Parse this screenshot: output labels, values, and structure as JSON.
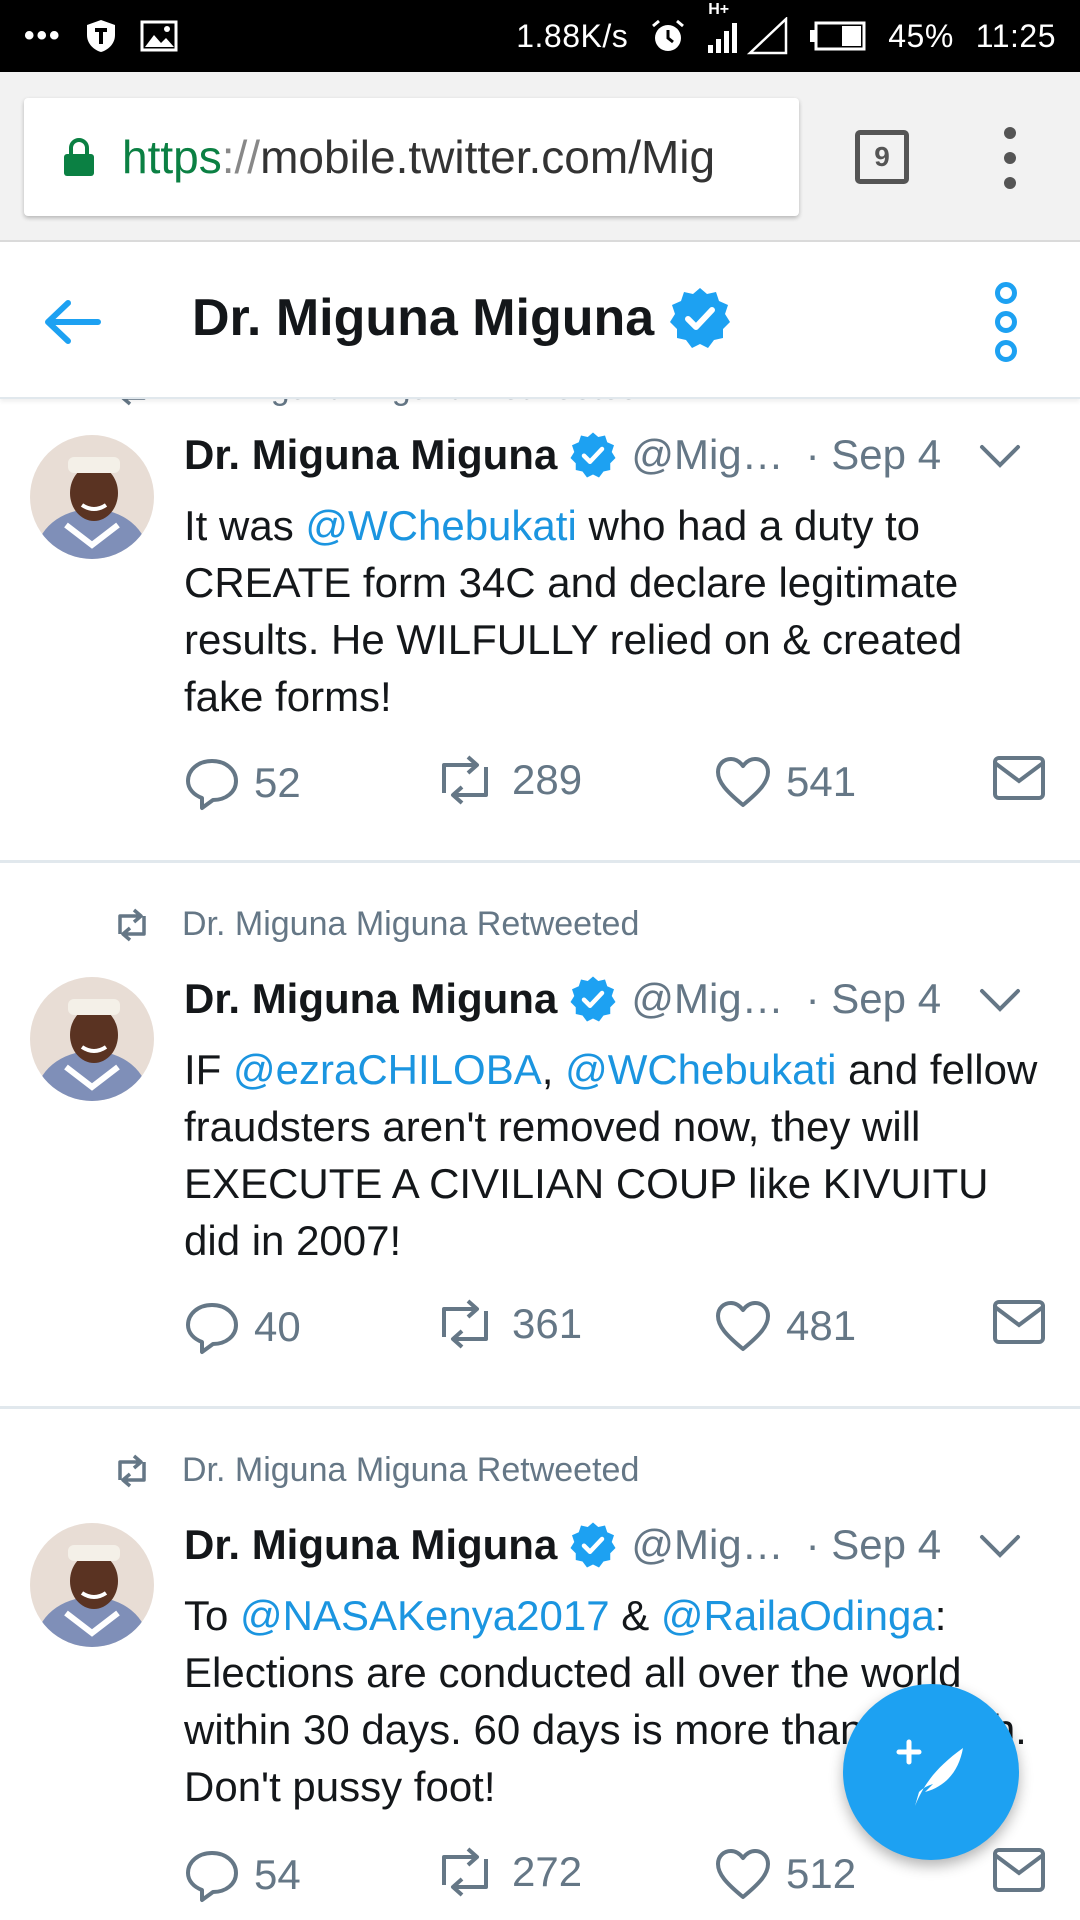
{
  "status_bar": {
    "speed": "1.88K/s",
    "network_label": "H+",
    "battery": "45%",
    "time": "11:25",
    "icons": [
      "more-dots-icon",
      "shield-app-icon",
      "image-icon",
      "alarm-icon",
      "signal-icon",
      "battery-icon"
    ]
  },
  "browser": {
    "url_scheme": "https",
    "url_sep": "://",
    "url_rest": "mobile.twitter.com/Mig",
    "tab_count": "9"
  },
  "header": {
    "title": "Dr. Miguna Miguna"
  },
  "colors": {
    "twitter_blue": "#1da1f2",
    "mention_blue": "#1b95e0",
    "secure_green": "#0b8043",
    "muted_gray": "#657786"
  },
  "partial_retweet_label": "Dr. Miguna Miguna Retweeted",
  "tweets": [
    {
      "retweeted_by": "",
      "name": "Dr. Miguna Miguna",
      "handle": "@Mig…",
      "date": "· Sep 4",
      "body_segments": [
        {
          "text": "It was ",
          "type": "text"
        },
        {
          "text": "@WChebukati",
          "type": "mention"
        },
        {
          "text": " who had a duty to CREATE form 34C and declare legitimate results. He WILFULLY relied on & created fake forms!",
          "type": "text"
        }
      ],
      "replies": "52",
      "retweets": "289",
      "likes": "541"
    },
    {
      "retweeted_by": "Dr. Miguna Miguna Retweeted",
      "name": "Dr. Miguna Miguna",
      "handle": "@Mig…",
      "date": "· Sep 4",
      "body_segments": [
        {
          "text": "IF ",
          "type": "text"
        },
        {
          "text": "@ezraCHILOBA",
          "type": "mention"
        },
        {
          "text": ", ",
          "type": "text"
        },
        {
          "text": "@WChebukati",
          "type": "mention"
        },
        {
          "text": " and fellow fraudsters aren't removed now, they will EXECUTE A CIVILIAN COUP like KIVUITU did in 2007!",
          "type": "text"
        }
      ],
      "replies": "40",
      "retweets": "361",
      "likes": "481"
    },
    {
      "retweeted_by": "Dr. Miguna Miguna Retweeted",
      "name": "Dr. Miguna Miguna",
      "handle": "@Mig…",
      "date": "· Sep 4",
      "body_segments": [
        {
          "text": "To ",
          "type": "text"
        },
        {
          "text": "@NASAKenya2017",
          "type": "mention"
        },
        {
          "text": " & ",
          "type": "text"
        },
        {
          "text": "@RailaOdinga",
          "type": "mention"
        },
        {
          "text": ": Elections are conducted all over the world within 30 days. 60 days is more than enough. Don't pussy foot!",
          "type": "text"
        }
      ],
      "replies": "54",
      "retweets": "272",
      "likes": "512"
    }
  ]
}
